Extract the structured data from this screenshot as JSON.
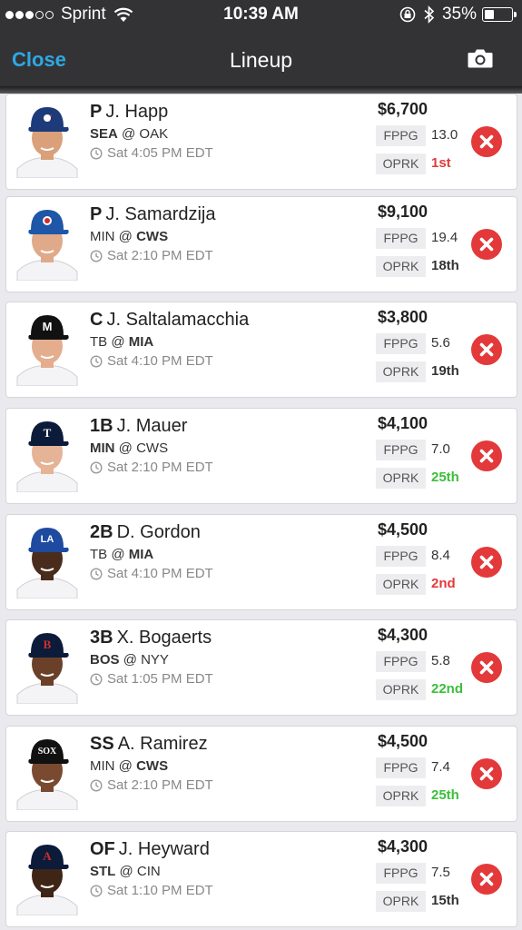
{
  "status_bar": {
    "carrier": "Sprint",
    "time": "10:39 AM",
    "battery": "35%",
    "battery_level": 0.35
  },
  "nav": {
    "close_label": "Close",
    "title": "Lineup",
    "camera_icon": "camera-icon"
  },
  "stat_labels": {
    "fppg": "FPPG",
    "oprk": "OPRK"
  },
  "rank_colors": {
    "good": "#e3393a",
    "bad": "#3bbf3b",
    "neutral": "#333333"
  },
  "players": [
    {
      "pos": "P",
      "name": "J. Happ",
      "team": "SEA",
      "at": "@",
      "opp": "OAK",
      "bold": "team",
      "time": "Sat 4:05 PM EDT",
      "salary": "$6,700",
      "fppg": "13.0",
      "oprk": "1st",
      "rank_color": "#e3393a",
      "cap": "#1d3a7a",
      "logo": "bluejays",
      "skin": "#d9a07a"
    },
    {
      "pos": "P",
      "name": "J. Samardzija",
      "team": "MIN",
      "at": "@",
      "opp": "CWS",
      "bold": "opp",
      "time": "Sat 2:10 PM EDT",
      "salary": "$9,100",
      "fppg": "19.4",
      "oprk": "18th",
      "rank_color": "#333333",
      "cap": "#1e56a8",
      "logo": "cubs",
      "skin": "#e0a98a"
    },
    {
      "pos": "C",
      "name": "J. Saltalamacchia",
      "team": "TB",
      "at": "@",
      "opp": "MIA",
      "bold": "opp",
      "time": "Sat 4:10 PM EDT",
      "salary": "$3,800",
      "fppg": "5.6",
      "oprk": "19th",
      "rank_color": "#333333",
      "cap": "#111111",
      "logo": "marlins",
      "skin": "#e3ad8e"
    },
    {
      "pos": "1B",
      "name": "J. Mauer",
      "team": "MIN",
      "at": "@",
      "opp": "CWS",
      "bold": "team",
      "time": "Sat 2:10 PM EDT",
      "salary": "$4,100",
      "fppg": "7.0",
      "oprk": "25th",
      "rank_color": "#3bbf3b",
      "cap": "#0c1b3a",
      "logo": "twins",
      "skin": "#e5b395"
    },
    {
      "pos": "2B",
      "name": "D. Gordon",
      "team": "TB",
      "at": "@",
      "opp": "MIA",
      "bold": "opp",
      "time": "Sat 4:10 PM EDT",
      "salary": "$4,500",
      "fppg": "8.4",
      "oprk": "2nd",
      "rank_color": "#e3393a",
      "cap": "#1e4aa0",
      "logo": "dodgers",
      "skin": "#4a2c1c"
    },
    {
      "pos": "3B",
      "name": "X. Bogaerts",
      "team": "BOS",
      "at": "@",
      "opp": "NYY",
      "bold": "team",
      "time": "Sat 1:05 PM EDT",
      "salary": "$4,300",
      "fppg": "5.8",
      "oprk": "22nd",
      "rank_color": "#3bbf3b",
      "cap": "#0c1b3a",
      "logo": "redsox",
      "skin": "#6b4029"
    },
    {
      "pos": "SS",
      "name": "A. Ramirez",
      "team": "MIN",
      "at": "@",
      "opp": "CWS",
      "bold": "opp",
      "time": "Sat 2:10 PM EDT",
      "salary": "$4,500",
      "fppg": "7.4",
      "oprk": "25th",
      "rank_color": "#3bbf3b",
      "cap": "#111111",
      "logo": "whitesox",
      "skin": "#7a4a30"
    },
    {
      "pos": "OF",
      "name": "J. Heyward",
      "team": "STL",
      "at": "@",
      "opp": "CIN",
      "bold": "team",
      "time": "Sat 1:10 PM EDT",
      "salary": "$4,300",
      "fppg": "7.5",
      "oprk": "15th",
      "rank_color": "#333333",
      "cap": "#0c1b3a",
      "logo": "braves",
      "skin": "#3f2516"
    }
  ]
}
